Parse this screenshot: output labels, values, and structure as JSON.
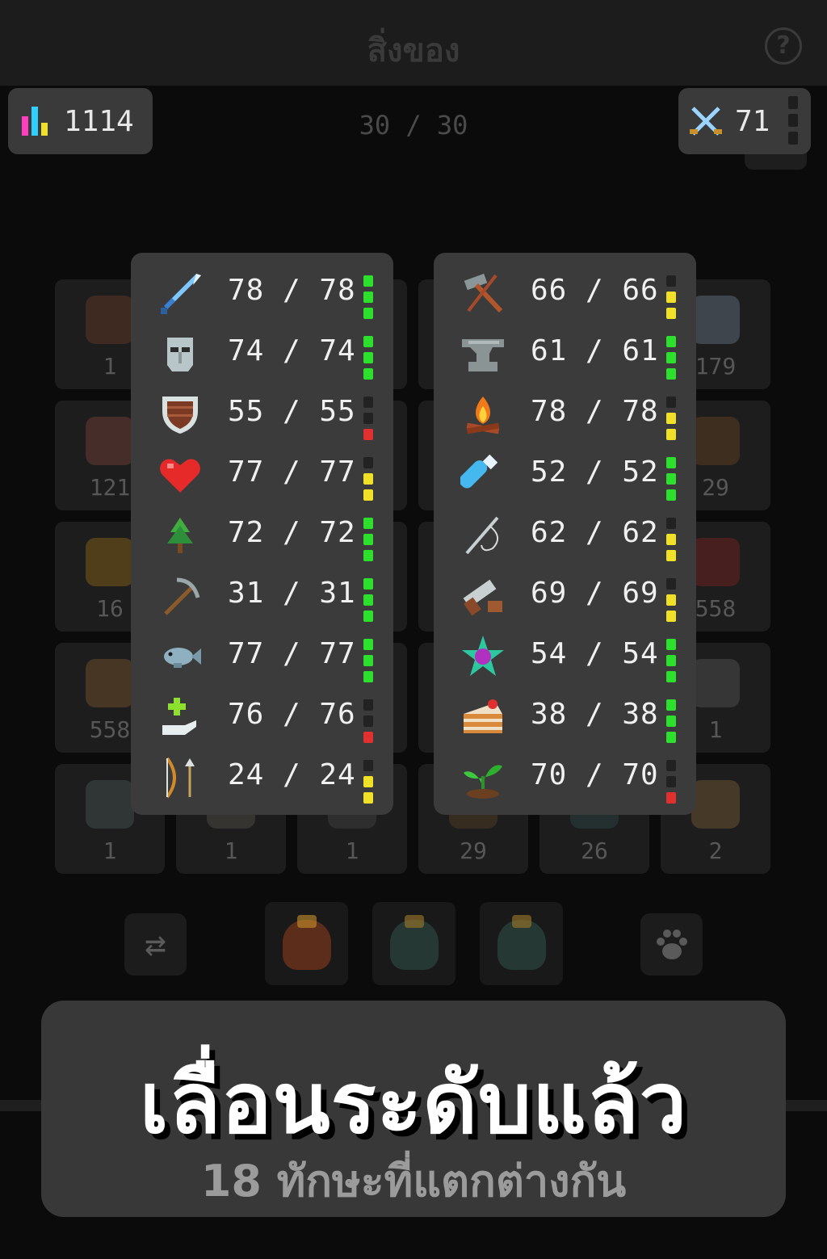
{
  "header": {
    "title": "สิ่งของ",
    "help_label": "?"
  },
  "stats": {
    "total_level": "1114",
    "combat_level": "71"
  },
  "inventory": {
    "capacity": "30 / 30",
    "slots": [
      {
        "qty": "1",
        "color": "#5a3522"
      },
      {
        "qty": "",
        "color": "#1d1d1d"
      },
      {
        "qty": "",
        "color": "#1d1d1d"
      },
      {
        "qty": "",
        "color": "#1d1d1d"
      },
      {
        "qty": "",
        "color": "#1d1d1d"
      },
      {
        "qty": "179",
        "color": "#5b6675"
      },
      {
        "qty": "121",
        "color": "#6a3b34"
      },
      {
        "qty": "",
        "color": "#1d1d1d"
      },
      {
        "qty": "",
        "color": "#1d1d1d"
      },
      {
        "qty": "",
        "color": "#1d1d1d"
      },
      {
        "qty": "",
        "color": "#1d1d1d"
      },
      {
        "qty": "29",
        "color": "#5a3d22"
      },
      {
        "qty": "16",
        "color": "#7a5a1a"
      },
      {
        "qty": "",
        "color": "#1d1d1d"
      },
      {
        "qty": "",
        "color": "#1d1d1d"
      },
      {
        "qty": "",
        "color": "#1d1d1d"
      },
      {
        "qty": "",
        "color": "#1d1d1d"
      },
      {
        "qty": "558",
        "color": "#6a2020"
      },
      {
        "qty": "558",
        "color": "#6b4a2a"
      },
      {
        "qty": "",
        "color": "#1d1d1d"
      },
      {
        "qty": "",
        "color": "#1d1d1d"
      },
      {
        "qty": "",
        "color": "#1d1d1d"
      },
      {
        "qty": "",
        "color": "#1d1d1d"
      },
      {
        "qty": "1",
        "color": "#4a4a4a"
      },
      {
        "qty": "1",
        "color": "#3f4a4a"
      },
      {
        "qty": "1",
        "color": "#4a4740"
      },
      {
        "qty": "1",
        "color": "#3d3d3d"
      },
      {
        "qty": "29",
        "color": "#4a3a22"
      },
      {
        "qty": "26",
        "color": "#2a4040"
      },
      {
        "qty": "2",
        "color": "#6a5030"
      }
    ]
  },
  "controls": {
    "swap_icon": "⇄",
    "pet_icon": "paw-icon"
  },
  "bags": [
    {
      "name": "bag-red",
      "color": "#8a3a1e",
      "knot": "#c8902a"
    },
    {
      "name": "bag-green",
      "color": "#2d4d45",
      "knot": "#a07a28"
    },
    {
      "name": "bag-green",
      "color": "#2d4d45",
      "knot": "#a07a28"
    }
  ],
  "skills_left": [
    {
      "icon": "sword-icon",
      "value": "78 / 78",
      "level": 3,
      "color": "#2ee02e"
    },
    {
      "icon": "helmet-icon",
      "value": "74 / 74",
      "level": 3,
      "color": "#2ee02e"
    },
    {
      "icon": "shield-icon",
      "value": "55 / 55",
      "level": 1,
      "color": "#e03030"
    },
    {
      "icon": "heart-icon",
      "value": "77 / 77",
      "level": 2,
      "color": "#f0e028"
    },
    {
      "icon": "tree-icon",
      "value": "72 / 72",
      "level": 3,
      "color": "#2ee02e"
    },
    {
      "icon": "pickaxe-icon",
      "value": "31 / 31",
      "level": 3,
      "color": "#2ee02e"
    },
    {
      "icon": "fish-icon",
      "value": "77 / 77",
      "level": 3,
      "color": "#2ee02e"
    },
    {
      "icon": "healing-hand-icon",
      "value": "76 / 76",
      "level": 1,
      "color": "#e03030"
    },
    {
      "icon": "bow-icon",
      "value": "24 / 24",
      "level": 2,
      "color": "#f0e028"
    }
  ],
  "skills_right": [
    {
      "icon": "hammer-icon",
      "value": "66 / 66",
      "level": 2,
      "color": "#f0e028"
    },
    {
      "icon": "anvil-icon",
      "value": "61 / 61",
      "level": 3,
      "color": "#2ee02e"
    },
    {
      "icon": "campfire-icon",
      "value": "78 / 78",
      "level": 2,
      "color": "#f0e028"
    },
    {
      "icon": "potion-vial-icon",
      "value": "52 / 52",
      "level": 3,
      "color": "#2ee02e"
    },
    {
      "icon": "needle-icon",
      "value": "62 / 62",
      "level": 2,
      "color": "#f0e028"
    },
    {
      "icon": "saw-icon",
      "value": "69 / 69",
      "level": 2,
      "color": "#f0e028"
    },
    {
      "icon": "magic-star-icon",
      "value": "54 / 54",
      "level": 3,
      "color": "#2ee02e"
    },
    {
      "icon": "cake-icon",
      "value": "38 / 38",
      "level": 3,
      "color": "#2ee02e"
    },
    {
      "icon": "sprout-icon",
      "value": "70 / 70",
      "level": 1,
      "color": "#e03030"
    }
  ],
  "banner": {
    "title": "เลื่อนระดับแล้ว",
    "subtitle": "18 ทักษะที่แตกต่างกัน"
  }
}
